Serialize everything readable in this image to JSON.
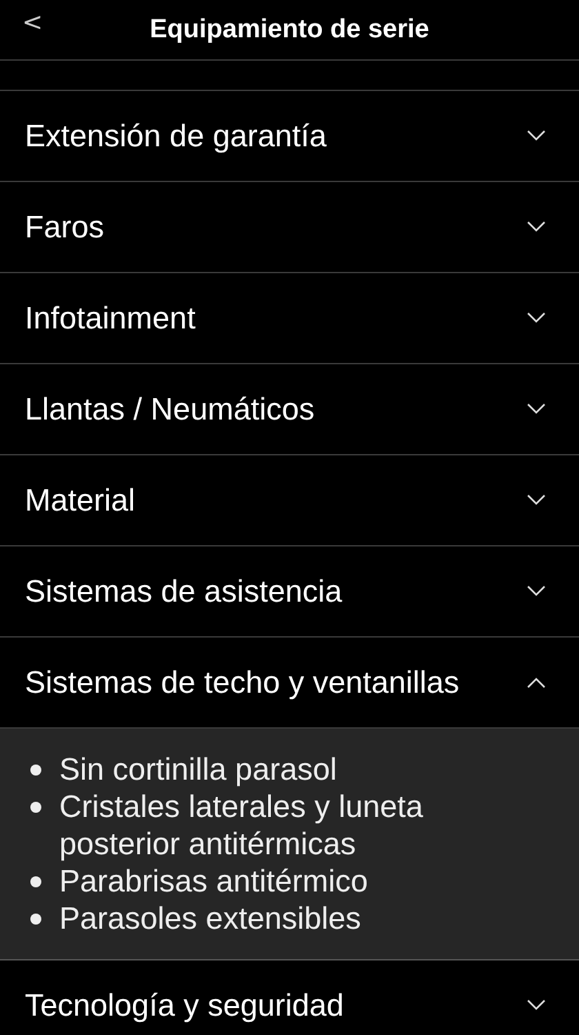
{
  "header": {
    "back_icon": "<",
    "title": "Equipamiento de serie"
  },
  "sections": [
    {
      "label": "Extensión de garantía",
      "expanded": false
    },
    {
      "label": "Faros",
      "expanded": false
    },
    {
      "label": "Infotainment",
      "expanded": false
    },
    {
      "label": "Llantas / Neumáticos",
      "expanded": false
    },
    {
      "label": "Material",
      "expanded": false
    },
    {
      "label": "Sistemas de asistencia",
      "expanded": false
    },
    {
      "label": "Sistemas de techo y ventanillas",
      "expanded": true,
      "items": [
        "Sin cortinilla parasol",
        "Cristales laterales y luneta posterior antitérmicas",
        "Parabrisas antitérmico",
        "Parasoles extensibles"
      ]
    },
    {
      "label": "Tecnología y seguridad",
      "expanded": false
    }
  ]
}
